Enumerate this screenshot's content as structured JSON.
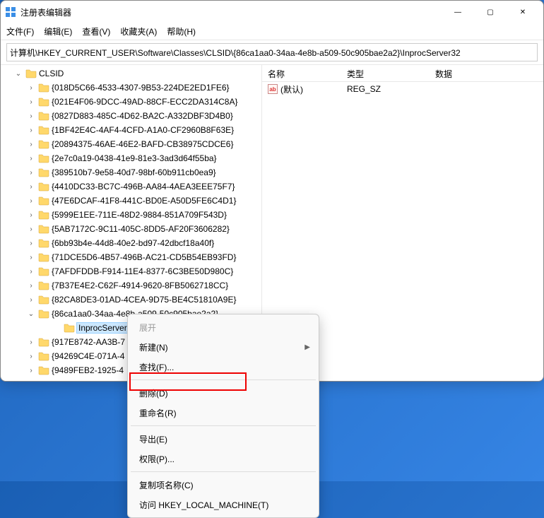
{
  "window": {
    "title": "注册表编辑器",
    "min": "—",
    "max": "▢",
    "close": "✕"
  },
  "menubar": [
    "文件(F)",
    "编辑(E)",
    "查看(V)",
    "收藏夹(A)",
    "帮助(H)"
  ],
  "address": "计算机\\HKEY_CURRENT_USER\\Software\\Classes\\CLSID\\{86ca1aa0-34aa-4e8b-a509-50c905bae2a2}\\InprocServer32",
  "tree": {
    "root": "CLSID",
    "items": [
      "{018D5C66-4533-4307-9B53-224DE2ED1FE6}",
      "{021E4F06-9DCC-49AD-88CF-ECC2DA314C8A}",
      "{0827D883-485C-4D62-BA2C-A332DBF3D4B0}",
      "{1BF42E4C-4AF4-4CFD-A1A0-CF2960B8F63E}",
      "{20894375-46AE-46E2-BAFD-CB38975CDCE6}",
      "{2e7c0a19-0438-41e9-81e3-3ad3d64f55ba}",
      "{389510b7-9e58-40d7-98bf-60b911cb0ea9}",
      "{4410DC33-BC7C-496B-AA84-4AEA3EEE75F7}",
      "{47E6DCAF-41F8-441C-BD0E-A50D5FE6C4D1}",
      "{5999E1EE-711E-48D2-9884-851A709F543D}",
      "{5AB7172C-9C11-405C-8DD5-AF20F3606282}",
      "{6bb93b4e-44d8-40e2-bd97-42dbcf18a40f}",
      "{71DCE5D6-4B57-496B-AC21-CD5B54EB93FD}",
      "{7AFDFDDB-F914-11E4-8377-6C3BE50D980C}",
      "{7B37E4E2-C62F-4914-9620-8FB5062718CC}",
      "{82CA8DE3-01AD-4CEA-9D75-BE4C51810A9E}"
    ],
    "expanded": "{86ca1aa0-34aa-4e8b-a509-50c905bae2a2}",
    "selected": "InprocServer32",
    "after": [
      "{917E8742-AA3B-7",
      "{94269C4E-071A-4",
      "{9489FEB2-1925-4"
    ]
  },
  "list": {
    "columns": {
      "name": "名称",
      "type": "类型",
      "data": "数据"
    },
    "rows": [
      {
        "name": "(默认)",
        "type": "REG_SZ",
        "data": ""
      }
    ]
  },
  "contextmenu": {
    "expand": "展开",
    "new": "新建(N)",
    "find": "查找(F)...",
    "delete": "删除(D)",
    "rename": "重命名(R)",
    "export": "导出(E)",
    "perms": "权限(P)...",
    "copyname": "复制项名称(C)",
    "goto": "访问 HKEY_LOCAL_MACHINE(T)"
  }
}
